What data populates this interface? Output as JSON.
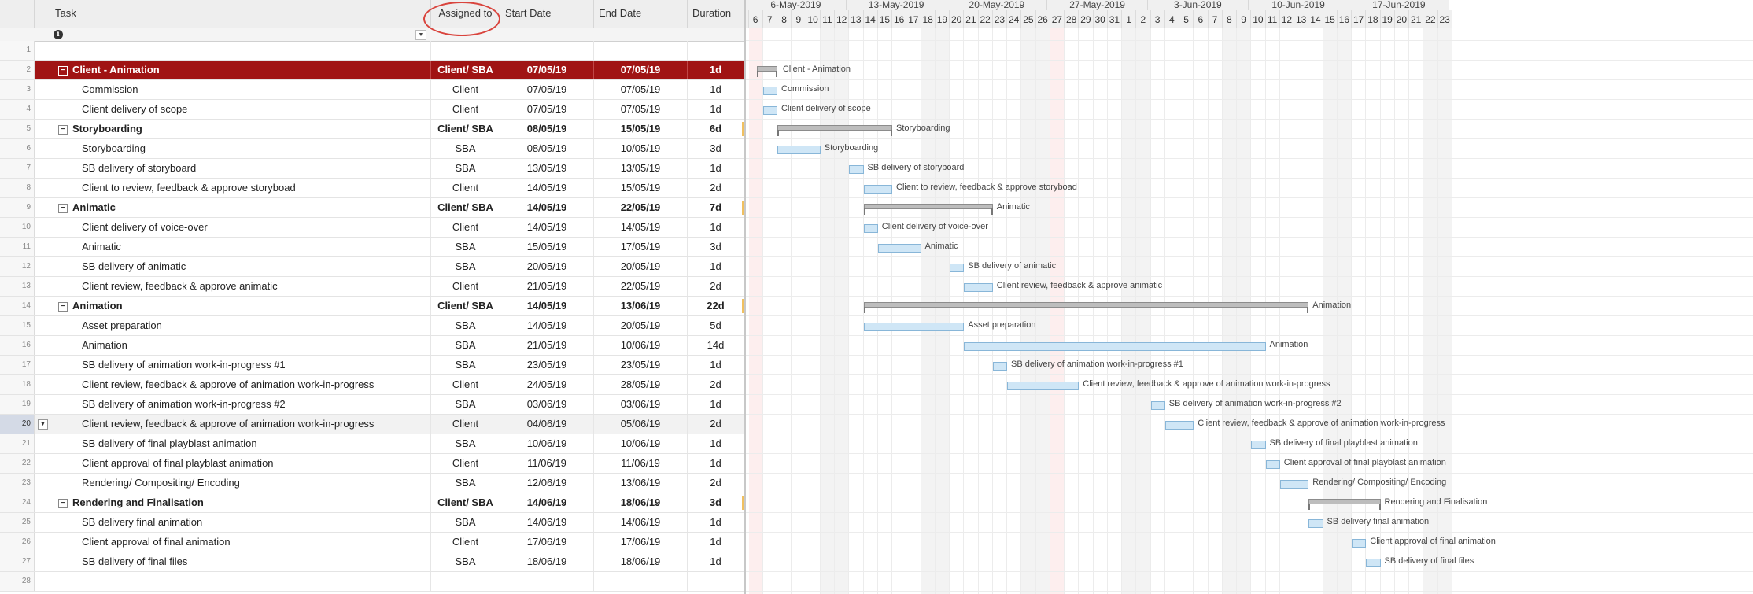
{
  "headers": {
    "task": "Task",
    "assigned": "Assigned to",
    "start": "Start Date",
    "end": "End Date",
    "duration": "Duration"
  },
  "icons": {
    "info": "info-icon",
    "dropdown": "chevron-down-icon",
    "collapse": "minus-box-icon"
  },
  "colors": {
    "main_row": "#a01414",
    "task_bar": "#cfe6f6",
    "summary_bar": "#bdbdbd",
    "annotation": "#d9443d"
  },
  "rows": [
    {
      "num": "1",
      "task": "",
      "assigned": "",
      "start": "",
      "end": "",
      "dur": "",
      "type": "empty"
    },
    {
      "num": "2",
      "task": "Client - Animation",
      "assigned": "Client/ SBA",
      "start": "07/05/19",
      "end": "07/05/19",
      "dur": "1d",
      "type": "main"
    },
    {
      "num": "3",
      "task": "Commission",
      "assigned": "Client",
      "start": "07/05/19",
      "end": "07/05/19",
      "dur": "1d",
      "type": "child"
    },
    {
      "num": "4",
      "task": "Client delivery of scope",
      "assigned": "Client",
      "start": "07/05/19",
      "end": "07/05/19",
      "dur": "1d",
      "type": "child"
    },
    {
      "num": "5",
      "task": "Storyboarding",
      "assigned": "Client/ SBA",
      "start": "08/05/19",
      "end": "15/05/19",
      "dur": "6d",
      "type": "sum"
    },
    {
      "num": "6",
      "task": "Storyboarding",
      "assigned": "SBA",
      "start": "08/05/19",
      "end": "10/05/19",
      "dur": "3d",
      "type": "child"
    },
    {
      "num": "7",
      "task": "SB delivery of storyboard",
      "assigned": "SBA",
      "start": "13/05/19",
      "end": "13/05/19",
      "dur": "1d",
      "type": "child"
    },
    {
      "num": "8",
      "task": "Client to review, feedback & approve storyboad",
      "assigned": "Client",
      "start": "14/05/19",
      "end": "15/05/19",
      "dur": "2d",
      "type": "child"
    },
    {
      "num": "9",
      "task": "Animatic",
      "assigned": "Client/ SBA",
      "start": "14/05/19",
      "end": "22/05/19",
      "dur": "7d",
      "type": "sum"
    },
    {
      "num": "10",
      "task": "Client delivery of voice-over",
      "assigned": "Client",
      "start": "14/05/19",
      "end": "14/05/19",
      "dur": "1d",
      "type": "child"
    },
    {
      "num": "11",
      "task": "Animatic",
      "assigned": "SBA",
      "start": "15/05/19",
      "end": "17/05/19",
      "dur": "3d",
      "type": "child"
    },
    {
      "num": "12",
      "task": "SB delivery of animatic",
      "assigned": "SBA",
      "start": "20/05/19",
      "end": "20/05/19",
      "dur": "1d",
      "type": "child"
    },
    {
      "num": "13",
      "task": "Client review, feedback & approve animatic",
      "assigned": "Client",
      "start": "21/05/19",
      "end": "22/05/19",
      "dur": "2d",
      "type": "child"
    },
    {
      "num": "14",
      "task": "Animation",
      "assigned": "Client/ SBA",
      "start": "14/05/19",
      "end": "13/06/19",
      "dur": "22d",
      "type": "sum"
    },
    {
      "num": "15",
      "task": "Asset preparation",
      "assigned": "SBA",
      "start": "14/05/19",
      "end": "20/05/19",
      "dur": "5d",
      "type": "child"
    },
    {
      "num": "16",
      "task": "Animation",
      "assigned": "SBA",
      "start": "21/05/19",
      "end": "10/06/19",
      "dur": "14d",
      "type": "child"
    },
    {
      "num": "17",
      "task": "SB delivery of animation work-in-progress #1",
      "assigned": "SBA",
      "start": "23/05/19",
      "end": "23/05/19",
      "dur": "1d",
      "type": "child"
    },
    {
      "num": "18",
      "task": "Client review, feedback & approve of animation work-in-progress",
      "assigned": "Client",
      "start": "24/05/19",
      "end": "28/05/19",
      "dur": "2d",
      "type": "child"
    },
    {
      "num": "19",
      "task": "SB delivery of animation work-in-progress #2",
      "assigned": "SBA",
      "start": "03/06/19",
      "end": "03/06/19",
      "dur": "1d",
      "type": "child"
    },
    {
      "num": "20",
      "task": "Client review, feedback & approve of animation work-in-progress",
      "assigned": "Client",
      "start": "04/06/19",
      "end": "05/06/19",
      "dur": "2d",
      "type": "child"
    },
    {
      "num": "21",
      "task": "SB delivery of final playblast animation",
      "assigned": "SBA",
      "start": "10/06/19",
      "end": "10/06/19",
      "dur": "1d",
      "type": "child"
    },
    {
      "num": "22",
      "task": "Client approval of final playblast animation",
      "assigned": "Client",
      "start": "11/06/19",
      "end": "11/06/19",
      "dur": "1d",
      "type": "child"
    },
    {
      "num": "23",
      "task": "Rendering/ Compositing/ Encoding",
      "assigned": "SBA",
      "start": "12/06/19",
      "end": "13/06/19",
      "dur": "2d",
      "type": "child"
    },
    {
      "num": "24",
      "task": "Rendering and Finalisation",
      "assigned": "Client/ SBA",
      "start": "14/06/19",
      "end": "18/06/19",
      "dur": "3d",
      "type": "sum"
    },
    {
      "num": "25",
      "task": "SB delivery final animation",
      "assigned": "SBA",
      "start": "14/06/19",
      "end": "14/06/19",
      "dur": "1d",
      "type": "child"
    },
    {
      "num": "26",
      "task": "Client approval of final animation",
      "assigned": "Client",
      "start": "17/06/19",
      "end": "17/06/19",
      "dur": "1d",
      "type": "child"
    },
    {
      "num": "27",
      "task": "SB delivery of final files",
      "assigned": "SBA",
      "start": "18/06/19",
      "end": "18/06/19",
      "dur": "1d",
      "type": "child"
    },
    {
      "num": "28",
      "task": "",
      "assigned": "",
      "start": "",
      "end": "",
      "dur": "",
      "type": "empty"
    }
  ],
  "selected_row": "20",
  "gantt": {
    "weeks": [
      "6-May-2019",
      "13-May-2019",
      "20-May-2019",
      "27-May-2019",
      "3-Jun-2019",
      "10-Jun-2019",
      "17-Jun-2019"
    ],
    "days": [
      "6",
      "7",
      "8",
      "9",
      "10",
      "11",
      "12",
      "13",
      "14",
      "15",
      "16",
      "17",
      "18",
      "19",
      "20",
      "21",
      "22",
      "23",
      "24",
      "25",
      "26",
      "27",
      "28",
      "29",
      "30",
      "31",
      "1",
      "2",
      "3",
      "4",
      "5",
      "6",
      "7",
      "8",
      "9",
      "10",
      "11",
      "12",
      "13",
      "14",
      "15",
      "16",
      "17",
      "18",
      "19",
      "20",
      "21",
      "22",
      "23"
    ],
    "weekend_days": [
      5,
      6,
      12,
      13,
      19,
      20,
      26,
      27,
      33,
      34,
      40,
      41,
      47,
      48
    ],
    "holiday_days": [
      0,
      21
    ],
    "bars": [
      {
        "row": 1,
        "type": "sum",
        "label": "Client - Animation",
        "startDay": 0.6,
        "endDay": 2,
        "labelDay": 2.1
      },
      {
        "row": 2,
        "type": "task",
        "label": "Commission",
        "startDay": 1,
        "endDay": 2
      },
      {
        "row": 3,
        "type": "task",
        "label": "Client delivery of scope",
        "startDay": 1,
        "endDay": 2
      },
      {
        "row": 4,
        "type": "sum",
        "label": "Storyboarding",
        "startDay": 2,
        "endDay": 10
      },
      {
        "row": 5,
        "type": "task",
        "label": "Storyboarding",
        "startDay": 2,
        "endDay": 5
      },
      {
        "row": 6,
        "type": "task",
        "label": "SB delivery of storyboard",
        "startDay": 7,
        "endDay": 8
      },
      {
        "row": 7,
        "type": "task",
        "label": "Client to review, feedback & approve storyboad",
        "startDay": 8,
        "endDay": 10
      },
      {
        "row": 8,
        "type": "sum",
        "label": "Animatic",
        "startDay": 8,
        "endDay": 17
      },
      {
        "row": 9,
        "type": "task",
        "label": "Client delivery of voice-over",
        "startDay": 8,
        "endDay": 9
      },
      {
        "row": 10,
        "type": "task",
        "label": "Animatic",
        "startDay": 9,
        "endDay": 12
      },
      {
        "row": 11,
        "type": "task",
        "label": "SB delivery of animatic",
        "startDay": 14,
        "endDay": 15
      },
      {
        "row": 12,
        "type": "task",
        "label": "Client review, feedback & approve animatic",
        "startDay": 15,
        "endDay": 17
      },
      {
        "row": 13,
        "type": "sum",
        "label": "Animation",
        "startDay": 8,
        "endDay": 39
      },
      {
        "row": 14,
        "type": "task",
        "label": "Asset preparation",
        "startDay": 8,
        "endDay": 15
      },
      {
        "row": 15,
        "type": "task",
        "label": "Animation",
        "startDay": 15,
        "endDay": 36
      },
      {
        "row": 16,
        "type": "task",
        "label": "SB delivery of animation work-in-progress #1",
        "startDay": 17,
        "endDay": 18
      },
      {
        "row": 17,
        "type": "task",
        "label": "Client review, feedback & approve of animation work-in-progress",
        "startDay": 18,
        "endDay": 23
      },
      {
        "row": 18,
        "type": "task",
        "label": "SB delivery of animation work-in-progress #2",
        "startDay": 28,
        "endDay": 29
      },
      {
        "row": 19,
        "type": "task",
        "label": "Client review, feedback & approve of animation work-in-progress",
        "startDay": 29,
        "endDay": 31
      },
      {
        "row": 20,
        "type": "task",
        "label": "SB delivery of final playblast animation",
        "startDay": 35,
        "endDay": 36
      },
      {
        "row": 21,
        "type": "task",
        "label": "Client approval of final playblast animation",
        "startDay": 36,
        "endDay": 37
      },
      {
        "row": 22,
        "type": "task",
        "label": "Rendering/ Compositing/ Encoding",
        "startDay": 37,
        "endDay": 39
      },
      {
        "row": 23,
        "type": "sum",
        "label": "Rendering and Finalisation",
        "startDay": 39,
        "endDay": 44
      },
      {
        "row": 24,
        "type": "task",
        "label": "SB delivery final animation",
        "startDay": 39,
        "endDay": 40
      },
      {
        "row": 25,
        "type": "task",
        "label": "Client approval of final animation",
        "startDay": 42,
        "endDay": 43
      },
      {
        "row": 26,
        "type": "task",
        "label": "SB delivery of final files",
        "startDay": 43,
        "endDay": 44
      }
    ]
  }
}
